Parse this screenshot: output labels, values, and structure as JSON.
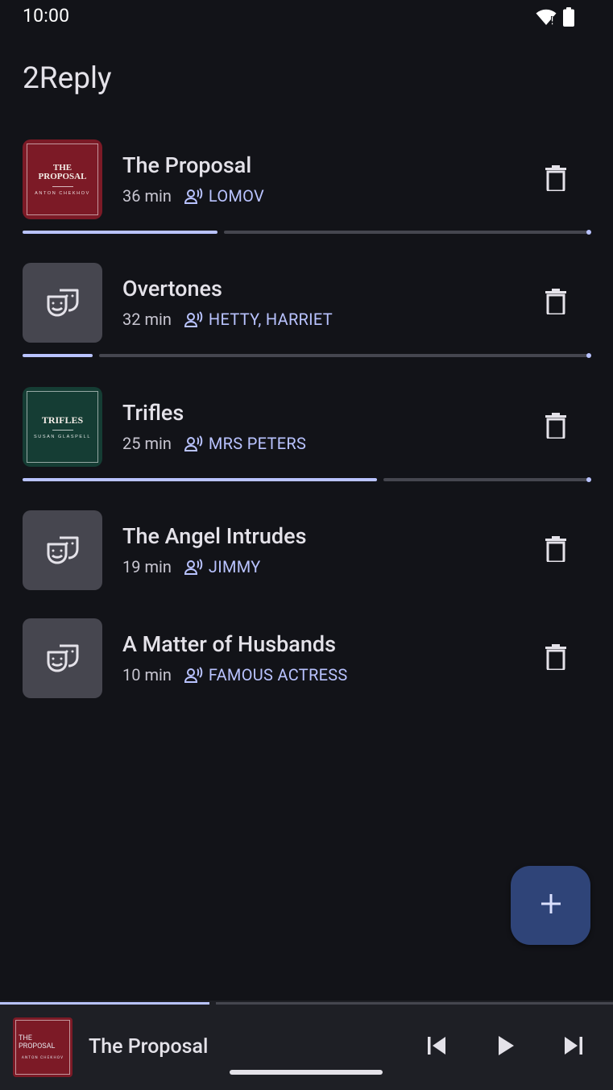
{
  "status_bar": {
    "time": "10:00"
  },
  "app": {
    "title": "2Reply"
  },
  "plays": [
    {
      "title": "The Proposal",
      "duration": "36 min",
      "role": "LOMOV",
      "cover": {
        "style": "book",
        "cover_title": "THE PROPOSAL",
        "cover_author": "ANTON CHEKHOV",
        "color": "#7c1a26"
      },
      "progress": 0.34
    },
    {
      "title": "Overtones",
      "duration": "32 min",
      "role": "HETTY, HARRIET",
      "cover": {
        "style": "generic",
        "icon": "theater-masks-icon"
      },
      "progress": 0.12
    },
    {
      "title": "Trifles",
      "duration": "25 min",
      "role": "MRS PETERS",
      "cover": {
        "style": "book",
        "cover_title": "TRIFLES",
        "cover_author": "SUSAN GLASPELL",
        "color": "#153d34"
      },
      "progress": 0.62
    },
    {
      "title": "The Angel Intrudes",
      "duration": "19 min",
      "role": "JIMMY",
      "cover": {
        "style": "generic",
        "icon": "theater-masks-icon"
      },
      "progress": null
    },
    {
      "title": "A Matter of Husbands",
      "duration": "10 min",
      "role": "FAMOUS ACTRESS",
      "cover": {
        "style": "generic",
        "icon": "theater-masks-icon"
      },
      "progress": null
    }
  ],
  "fab": {
    "icon": "plus-icon"
  },
  "player": {
    "title": "The Proposal",
    "cover_title": "THE PROPOSAL",
    "cover_author": "ANTON CHEKHOV",
    "progress": 0.34,
    "controls": [
      "skip-previous-icon",
      "play-icon",
      "skip-next-icon"
    ]
  },
  "colors": {
    "background": "#121318",
    "accent": "#b9c3ff",
    "fab": "#2f4478",
    "generic_cover": "#46464f"
  }
}
